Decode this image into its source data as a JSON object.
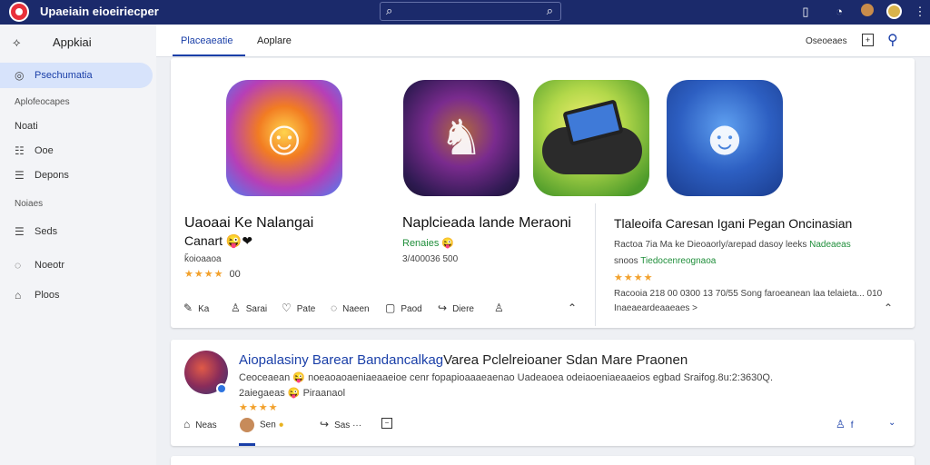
{
  "topbar": {
    "title": "Upaeiain eioeiriecper",
    "search_left_icon": "⌕",
    "search_right_icon": "⌕",
    "icons": [
      "bookmark-icon",
      "notification-icon",
      "user-avatar",
      "profile-avatar",
      "more-icon"
    ]
  },
  "sidebar": {
    "header": "Appkiai",
    "active": "Psechumatia",
    "section1": "Aplofeocapes",
    "items1": [
      {
        "label": "Noati"
      },
      {
        "label": "Ooe"
      },
      {
        "label": "Depons"
      }
    ],
    "section2": "Noiaes",
    "items2": [
      {
        "label": "Seds"
      },
      {
        "label": "Noeotr"
      },
      {
        "label": "Ploos"
      }
    ]
  },
  "tabs": {
    "tab1": "Placeaeatie",
    "tab2": "Aoplare",
    "right_label": "Oseoeaes"
  },
  "card1": {
    "col1": {
      "title": "Uaoaai Ke Nalangai",
      "subtitle": "Canart 😜❤",
      "meta": "ǩoioaaoa",
      "stars": "★★★★",
      "rating": "00"
    },
    "col2": {
      "title": "Naplcieada lande Meraoni",
      "tag": "Renaies",
      "tag_emoji": "😜",
      "meta": "3/400036 500"
    },
    "col3": {
      "title": "Tlaleoifa Caresan Igani Pegan Oncinasian",
      "line1": "Ractoa 7ia Ma ke Dieoaorly/arepad dasoy leeks",
      "line1_green": "Nadeaeas",
      "line2": "snoos",
      "line2_green": "Tiedocenreognaoa",
      "stars": "★★★★",
      "line3": "Racooia 218 00 0300 13 70/55 Song faroeanean laa telaieta... 010",
      "line4": "Inaeaeardeaaeaes >"
    },
    "actions": [
      "Ka",
      "Sarai",
      "Pate",
      "Naeen",
      "Paod",
      "Diere"
    ]
  },
  "card2": {
    "title_blue": "Aiopalasiny Barear Bandancalkag",
    "title_dark": "Varea Pclelreioaner Sdan Mare Praonen",
    "desc": "Ceoceaean 😜 noeaoaoaeniaeaaeioe cenr fopapioaaaeaenao Uadeaoea odeiaoeniaeaaeios egbad Sraifog.8u:2:3630Q.",
    "tag": "2aiegaeas 😜 Piraanaol",
    "stars": "★★★★",
    "actions": {
      "a1": "Neas",
      "a2": "Sen",
      "a3": "Sas"
    }
  }
}
